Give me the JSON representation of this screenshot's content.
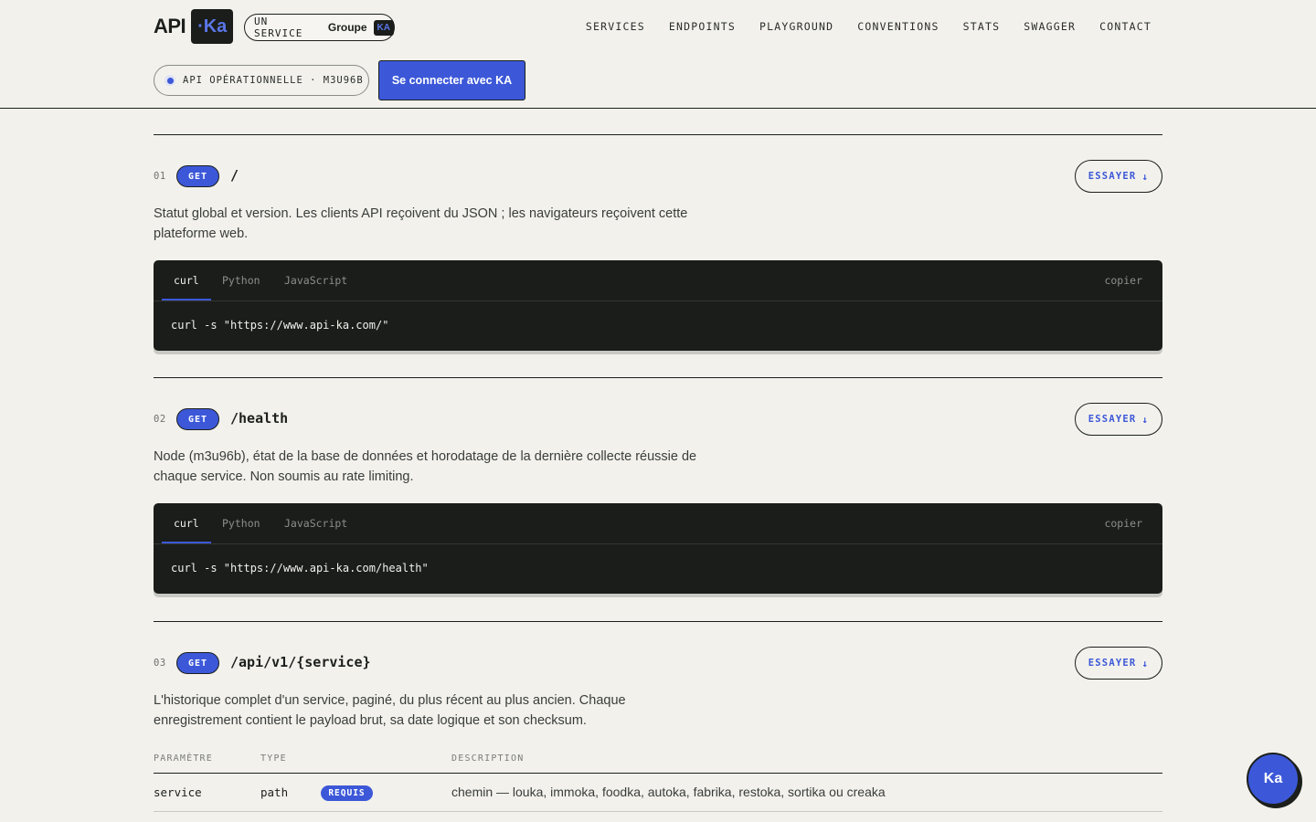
{
  "header": {
    "logo_text": "API",
    "logo_badge": "·Ka",
    "service_label": "UN SERVICE",
    "service_group": "Groupe",
    "service_badge": "KA",
    "nav": [
      "SERVICES",
      "ENDPOINTS",
      "PLAYGROUND",
      "CONVENTIONS",
      "STATS",
      "SWAGGER",
      "CONTACT"
    ],
    "status_text": "API OPÉRATIONNELLE · M3U96B",
    "login_label": "Se connecter avec KA"
  },
  "code_tabs": {
    "curl": "curl",
    "python": "Python",
    "javascript": "JavaScript",
    "copy": "copier"
  },
  "try_label": "ESSAYER",
  "try_arrow": "↓",
  "endpoints": [
    {
      "num": "01",
      "method": "GET",
      "path": "/",
      "description": "Statut global et version. Les clients API reçoivent du JSON ; les navigateurs reçoivent cette plateforme web.",
      "code": "curl -s \"https://www.api-ka.com/\""
    },
    {
      "num": "02",
      "method": "GET",
      "path": "/health",
      "description": "Node (m3u96b), état de la base de données et horodatage de la dernière collecte réussie de chaque service. Non soumis au rate limiting.",
      "code": "curl -s \"https://www.api-ka.com/health\""
    },
    {
      "num": "03",
      "method": "GET",
      "path": "/api/v1/{service}",
      "description": "L'historique complet d'un service, paginé, du plus récent au plus ancien. Chaque enregistrement contient le payload brut, sa date logique et son checksum."
    }
  ],
  "params": {
    "headers": [
      "PARAMÈTRE",
      "TYPE",
      "DESCRIPTION"
    ],
    "rows": [
      {
        "name": "service",
        "type": "path",
        "required": "REQUIS",
        "description": "chemin — louka, immoka, foodka, autoka, fabrika, restoka, sortika ou creaka"
      }
    ]
  },
  "fab_label": "Ka",
  "colors": {
    "accent": "#3c58d8",
    "background": "#f2f1ec",
    "dark": "#1a1d1a"
  }
}
